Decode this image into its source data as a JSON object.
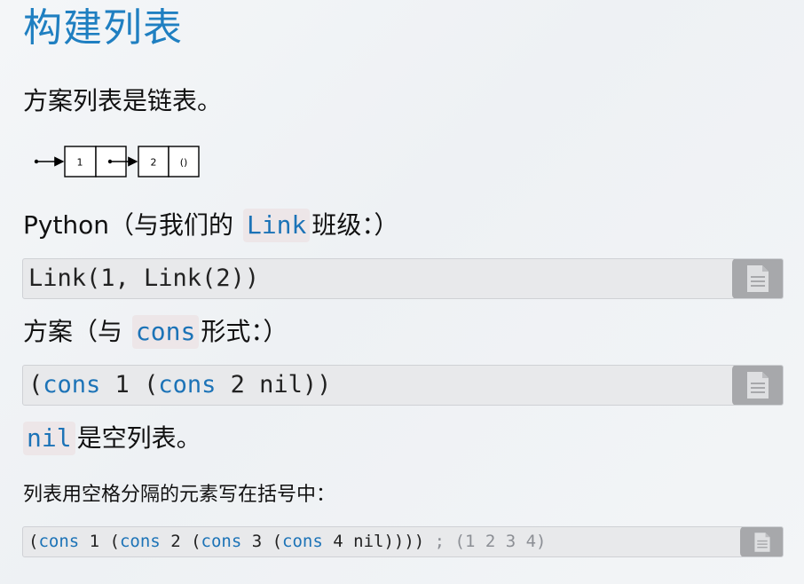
{
  "title": "构建列表",
  "intro": "方案列表是链表。",
  "diagram": {
    "cell1_value": "1",
    "cell2_value": "2",
    "cell2_rest": "()"
  },
  "python_para": {
    "prefix": "Python（与我们的 ",
    "code": "Link",
    "suffix": "班级：）"
  },
  "python_code": {
    "text": "Link(1, Link(2))"
  },
  "scheme_para": {
    "prefix": "方案（与 ",
    "code": "cons",
    "suffix": "形式：）"
  },
  "scheme_code": {
    "p1": "(",
    "kw1": "cons",
    "p2": " 1 (",
    "kw2": "cons",
    "p3": " 2 nil))"
  },
  "nil_para": {
    "code": "nil",
    "suffix": "是空列表。"
  },
  "space_para": "列表用空格分隔的元素写在括号中：",
  "long_code": {
    "p1": "(",
    "kw1": "cons",
    "p2": " 1 (",
    "kw2": "cons",
    "p3": " 2 (",
    "kw3": "cons",
    "p4": " 3 (",
    "kw4": "cons",
    "p5": " 4 nil))))",
    "comment": "   ; (1 2 3 4)"
  },
  "icons": {
    "copy": "copy-document-icon"
  },
  "colors": {
    "title": "#1f7fc1",
    "keyword": "#1c73b7",
    "code_bg": "#e8e9eb",
    "copy_button": "#a7a8ab"
  }
}
